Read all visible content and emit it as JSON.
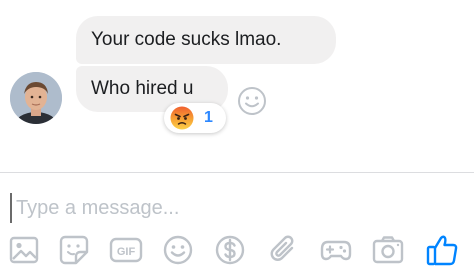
{
  "conversation": {
    "messages": [
      {
        "text": "Your code sucks lmao."
      },
      {
        "text": "Who hired u"
      }
    ],
    "reaction": {
      "emoji": "angry-face-icon",
      "count": "1"
    },
    "avatar": "avatar-photo"
  },
  "composer": {
    "placeholder": "Type a message...",
    "tools": [
      "image-icon",
      "sticker-icon",
      "gif-icon",
      "emoji-icon",
      "payment-icon",
      "attachment-icon",
      "game-icon",
      "camera-icon",
      "like-icon"
    ],
    "gif_label": "GIF"
  },
  "colors": {
    "bubble": "#f1f0f0",
    "icon_gray": "#bec3c9",
    "accent_blue": "#0084ff",
    "count_blue": "#2d88ff"
  }
}
